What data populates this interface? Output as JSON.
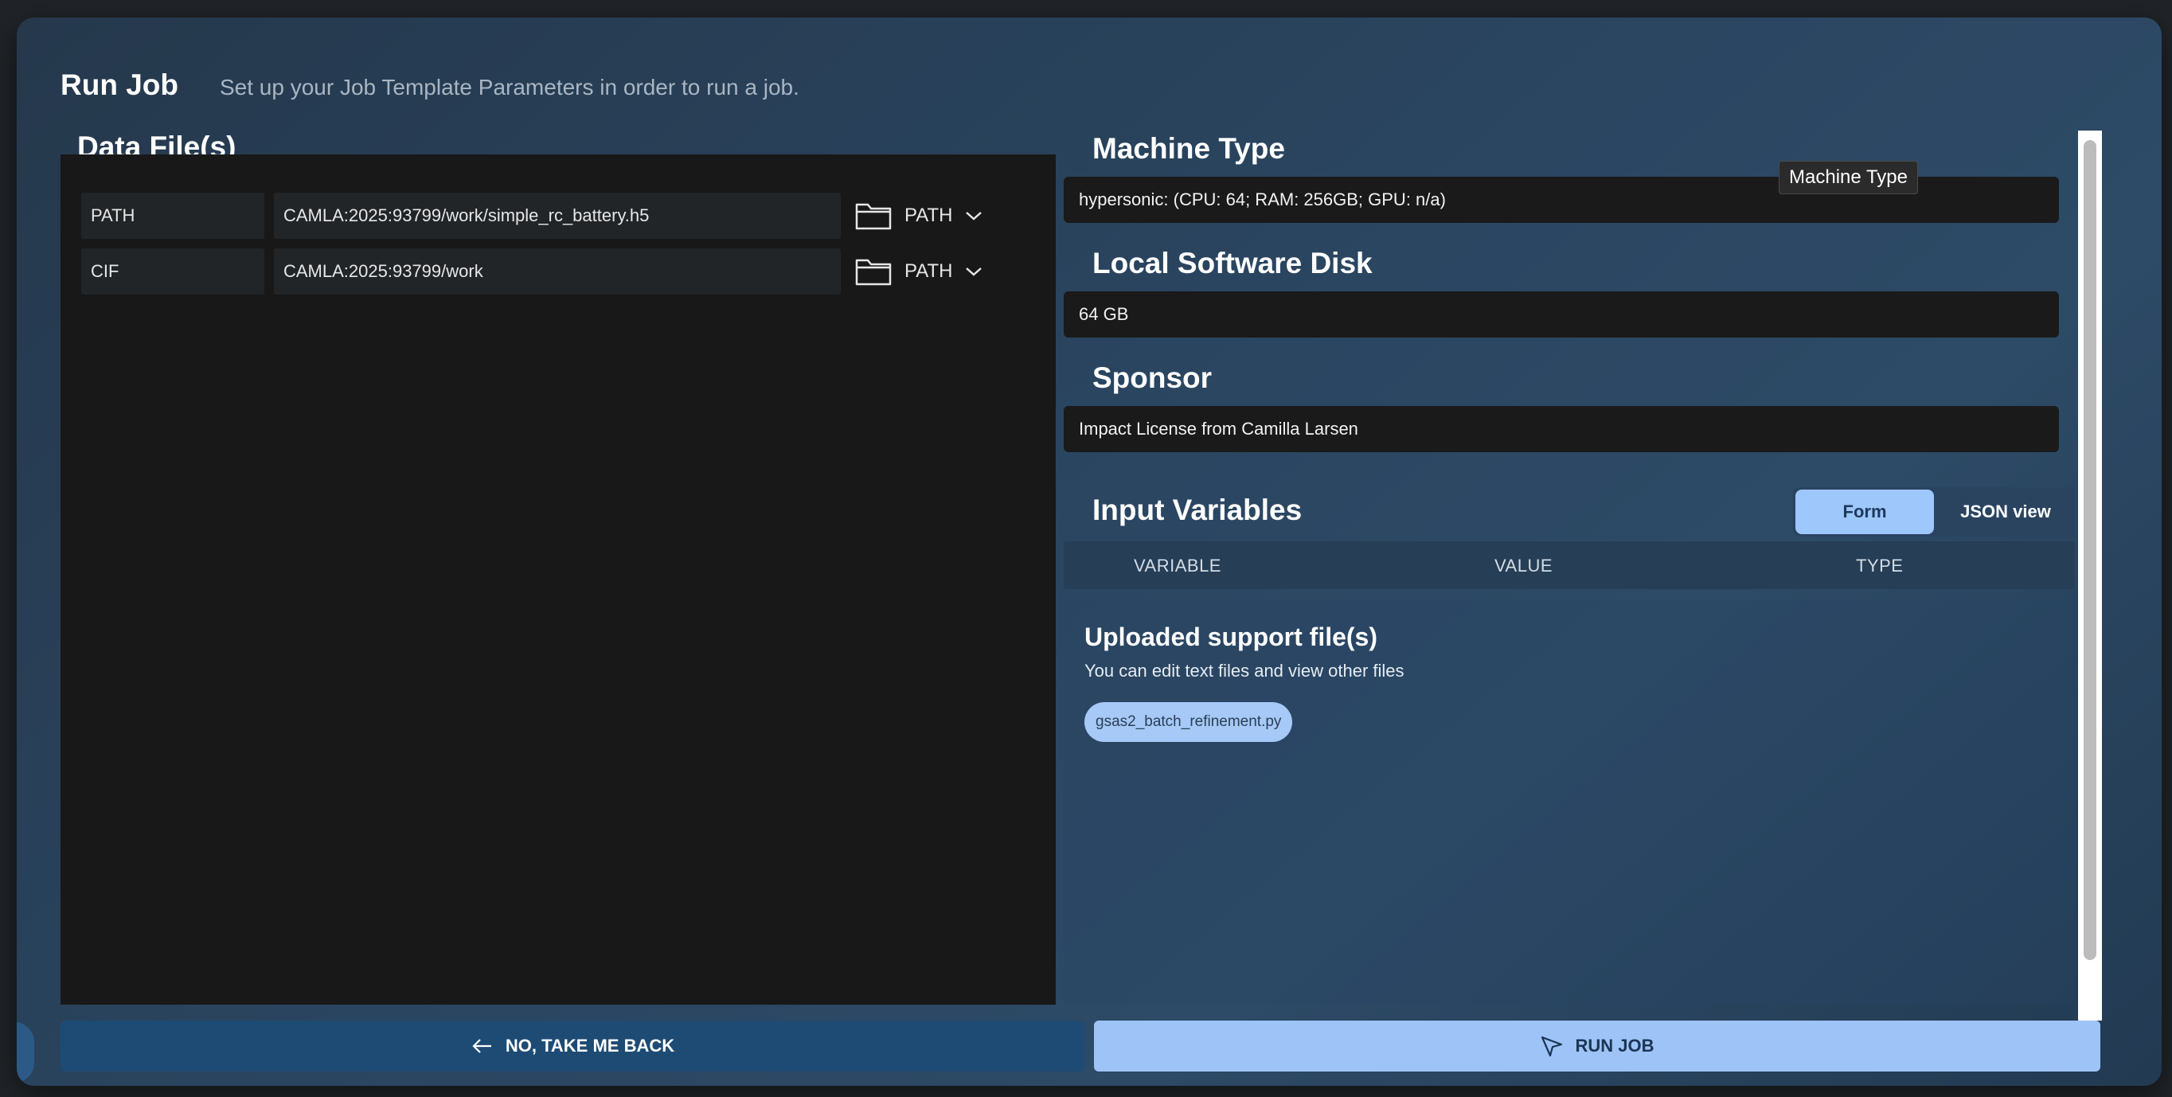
{
  "header": {
    "title": "Run Job",
    "subtitle": "Set up your Job Template Parameters in order to run a job."
  },
  "data_files": {
    "title": "Data File(s)",
    "rows": [
      {
        "label": "PATH",
        "path": "CAMLA:2025:93799/work/simple_rc_battery.h5",
        "type_label": "PATH"
      },
      {
        "label": "CIF",
        "path": "CAMLA:2025:93799/work",
        "type_label": "PATH"
      }
    ]
  },
  "machine_type": {
    "title": "Machine Type",
    "value": "hypersonic: (CPU: 64; RAM: 256GB; GPU: n/a)",
    "tooltip": "Machine Type"
  },
  "local_disk": {
    "title": "Local Software Disk",
    "value": "64 GB"
  },
  "sponsor": {
    "title": "Sponsor",
    "value": "Impact License from Camilla Larsen"
  },
  "input_variables": {
    "title": "Input Variables",
    "toggle": {
      "form_label": "Form",
      "json_label": "JSON view",
      "active": "form"
    },
    "columns": [
      "VARIABLE",
      "VALUE",
      "TYPE"
    ]
  },
  "support_files": {
    "title": "Uploaded support file(s)",
    "description": "You can edit text files and view other files",
    "files": [
      "gsas2_batch_refinement.py"
    ]
  },
  "footer": {
    "back_label": "NO, TAKE ME BACK",
    "run_label": "RUN JOB"
  },
  "colors": {
    "accent": "#9ec3f7",
    "back_button": "#1e4b74"
  },
  "icons": {
    "folder": "folder-icon",
    "chevron": "chevron-down-icon",
    "back": "arrow-left-icon",
    "run": "send-icon"
  }
}
